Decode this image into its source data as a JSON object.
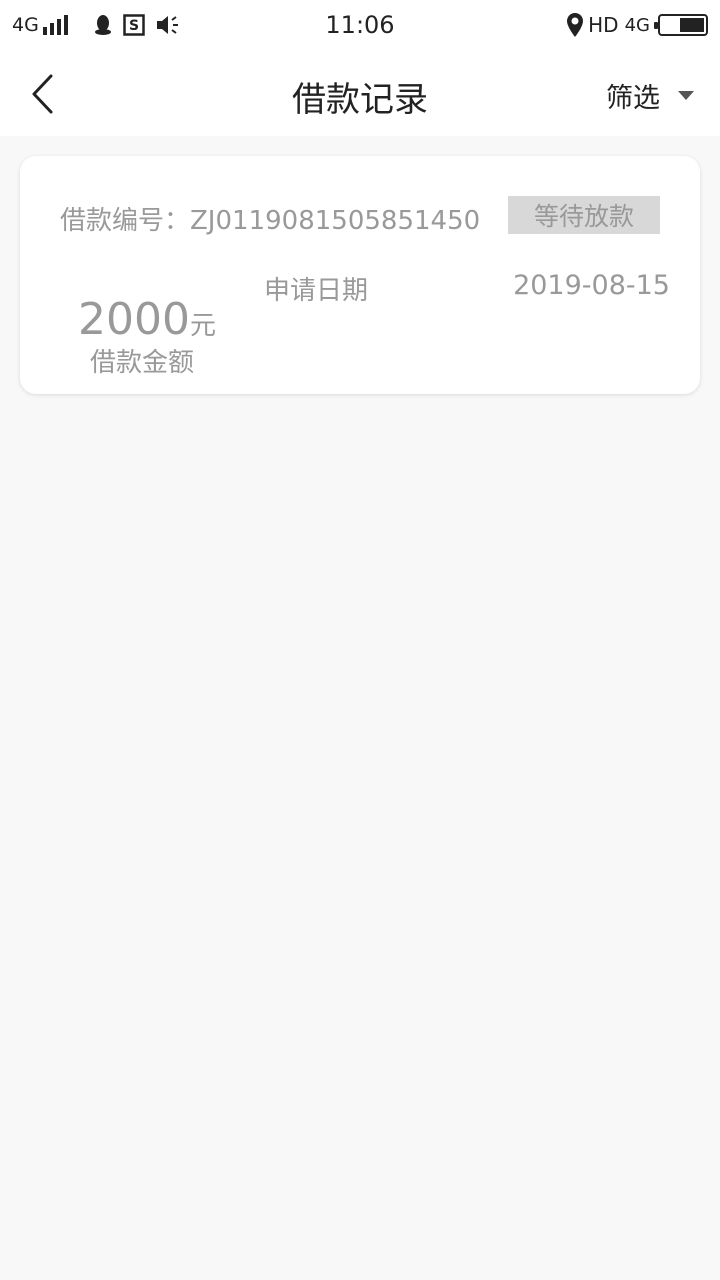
{
  "status_bar": {
    "network_left": "4G",
    "time": "11:06",
    "hd": "HD",
    "network_right": "4G",
    "icons": [
      "signal-icon",
      "qq-icon",
      "s-app-icon",
      "volume-icon",
      "location-icon",
      "battery-icon"
    ]
  },
  "nav": {
    "title": "借款记录",
    "filter_label": "筛选",
    "back_icon": "chevron-left-icon"
  },
  "records": [
    {
      "loan_no_label": "借款编号：ZJ0119081505851450",
      "status": "等待放款",
      "apply_date_label": "申请日期",
      "apply_date": "2019-08-15",
      "amount": "2000",
      "amount_unit": "元",
      "amount_label": "借款金额"
    }
  ],
  "colors": {
    "background": "#f8f8f8",
    "card": "#ffffff",
    "muted_text": "#999999",
    "badge_bg": "#d8d8d8"
  }
}
